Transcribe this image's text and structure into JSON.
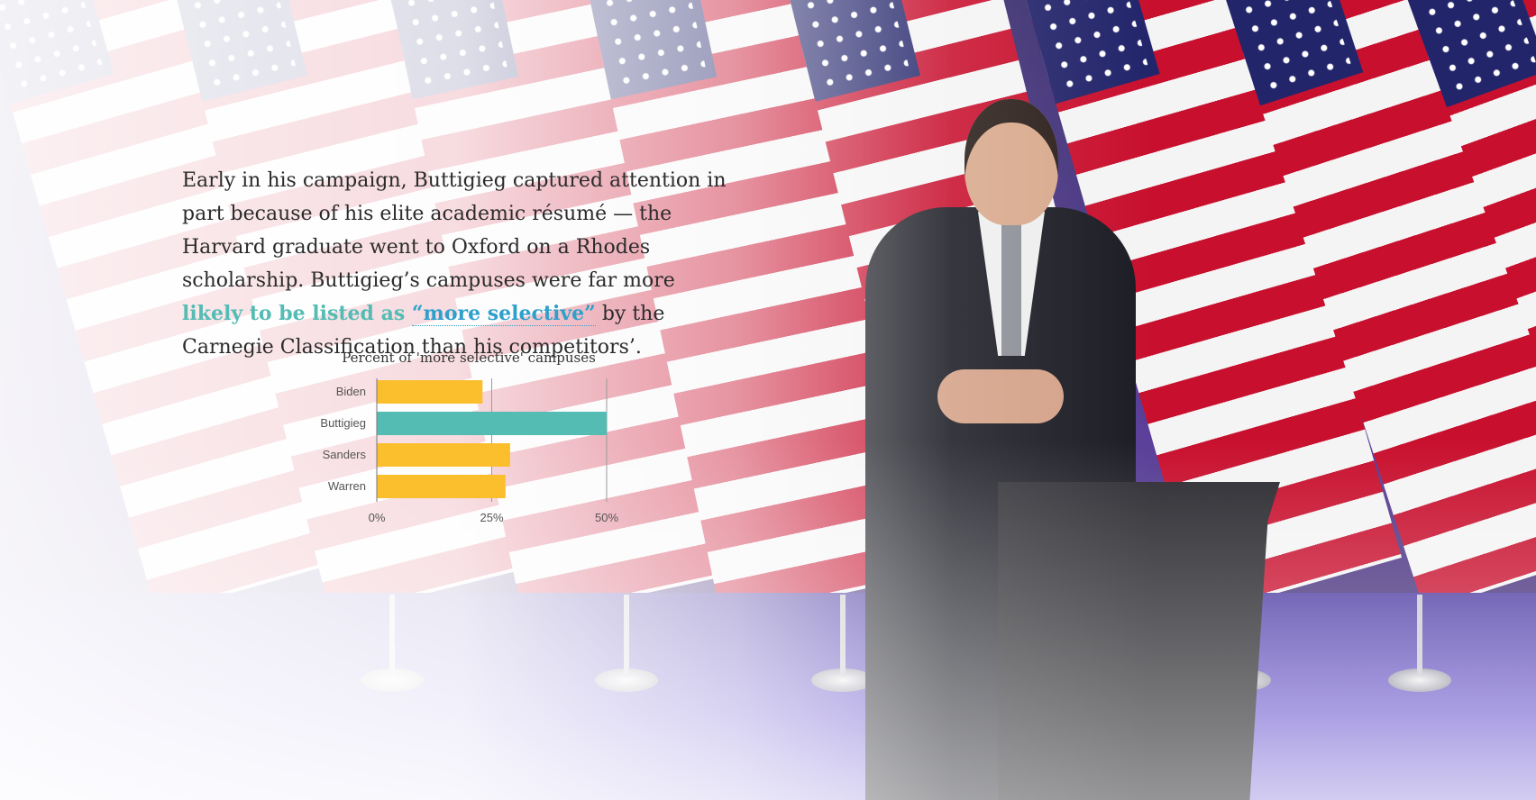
{
  "article": {
    "p_before": "Early in his campaign, Buttigieg captured attention in part because of his elite academic résumé — the Harvard graduate went to Oxford on a Rhodes scholarship. Buttigieg’s campuses were far more ",
    "highlight_text": "likely to be listed as ",
    "highlight_link_text": "“more selective”",
    "p_after": " by the Carnegie Classification than his competitors’."
  },
  "colors": {
    "highlight": "#55bcb4",
    "link": "#2fa0cc",
    "bar_default": "#fbbf2d",
    "bar_highlight": "#55bcb4"
  },
  "chart_data": {
    "type": "bar",
    "orientation": "horizontal",
    "title": "Percent of 'more selective' campuses",
    "categories": [
      "Biden",
      "Buttigieg",
      "Sanders",
      "Warren"
    ],
    "values": [
      23,
      50,
      29,
      28
    ],
    "highlighted_category": "Buttigieg",
    "xlim": [
      0,
      50
    ],
    "xticks": [
      0,
      25,
      50
    ],
    "xtick_labels": [
      "0%",
      "25%",
      "50%"
    ],
    "grid": true
  }
}
